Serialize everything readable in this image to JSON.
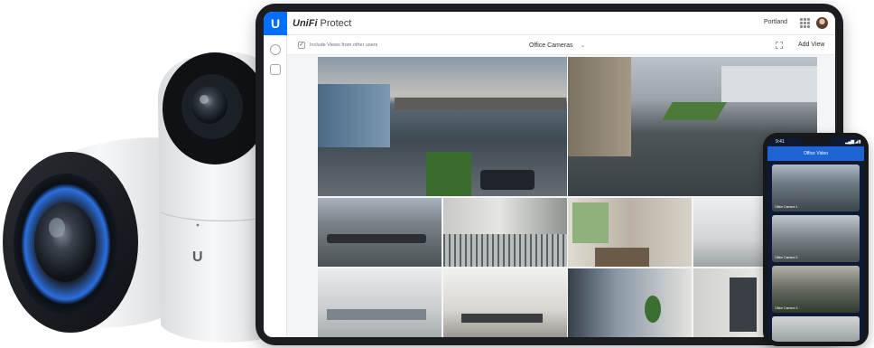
{
  "tablet": {
    "app_title_brand": "UniFi",
    "app_title_name": "Protect",
    "site_name": "Portland",
    "logo_glyph": "U",
    "include_views_label": "Include Views from other users",
    "include_checked": true,
    "current_view": "Office Cameras",
    "add_view_label": "Add View",
    "accent_color": "#006fff"
  },
  "phone": {
    "time": "9:41",
    "status": "▂▄▆ ◢ ▮",
    "header_title": "Office Video",
    "cards": [
      {
        "camera": "Office Camera 1",
        "status": ""
      },
      {
        "camera": "Office Camera 2",
        "status": ""
      },
      {
        "camera": "Office Camera 3",
        "status": ""
      }
    ]
  },
  "hero": {
    "camera_logo_glyph": "U",
    "icons": [
      "bullet-camera-icon",
      "dome-camera-icon"
    ]
  }
}
